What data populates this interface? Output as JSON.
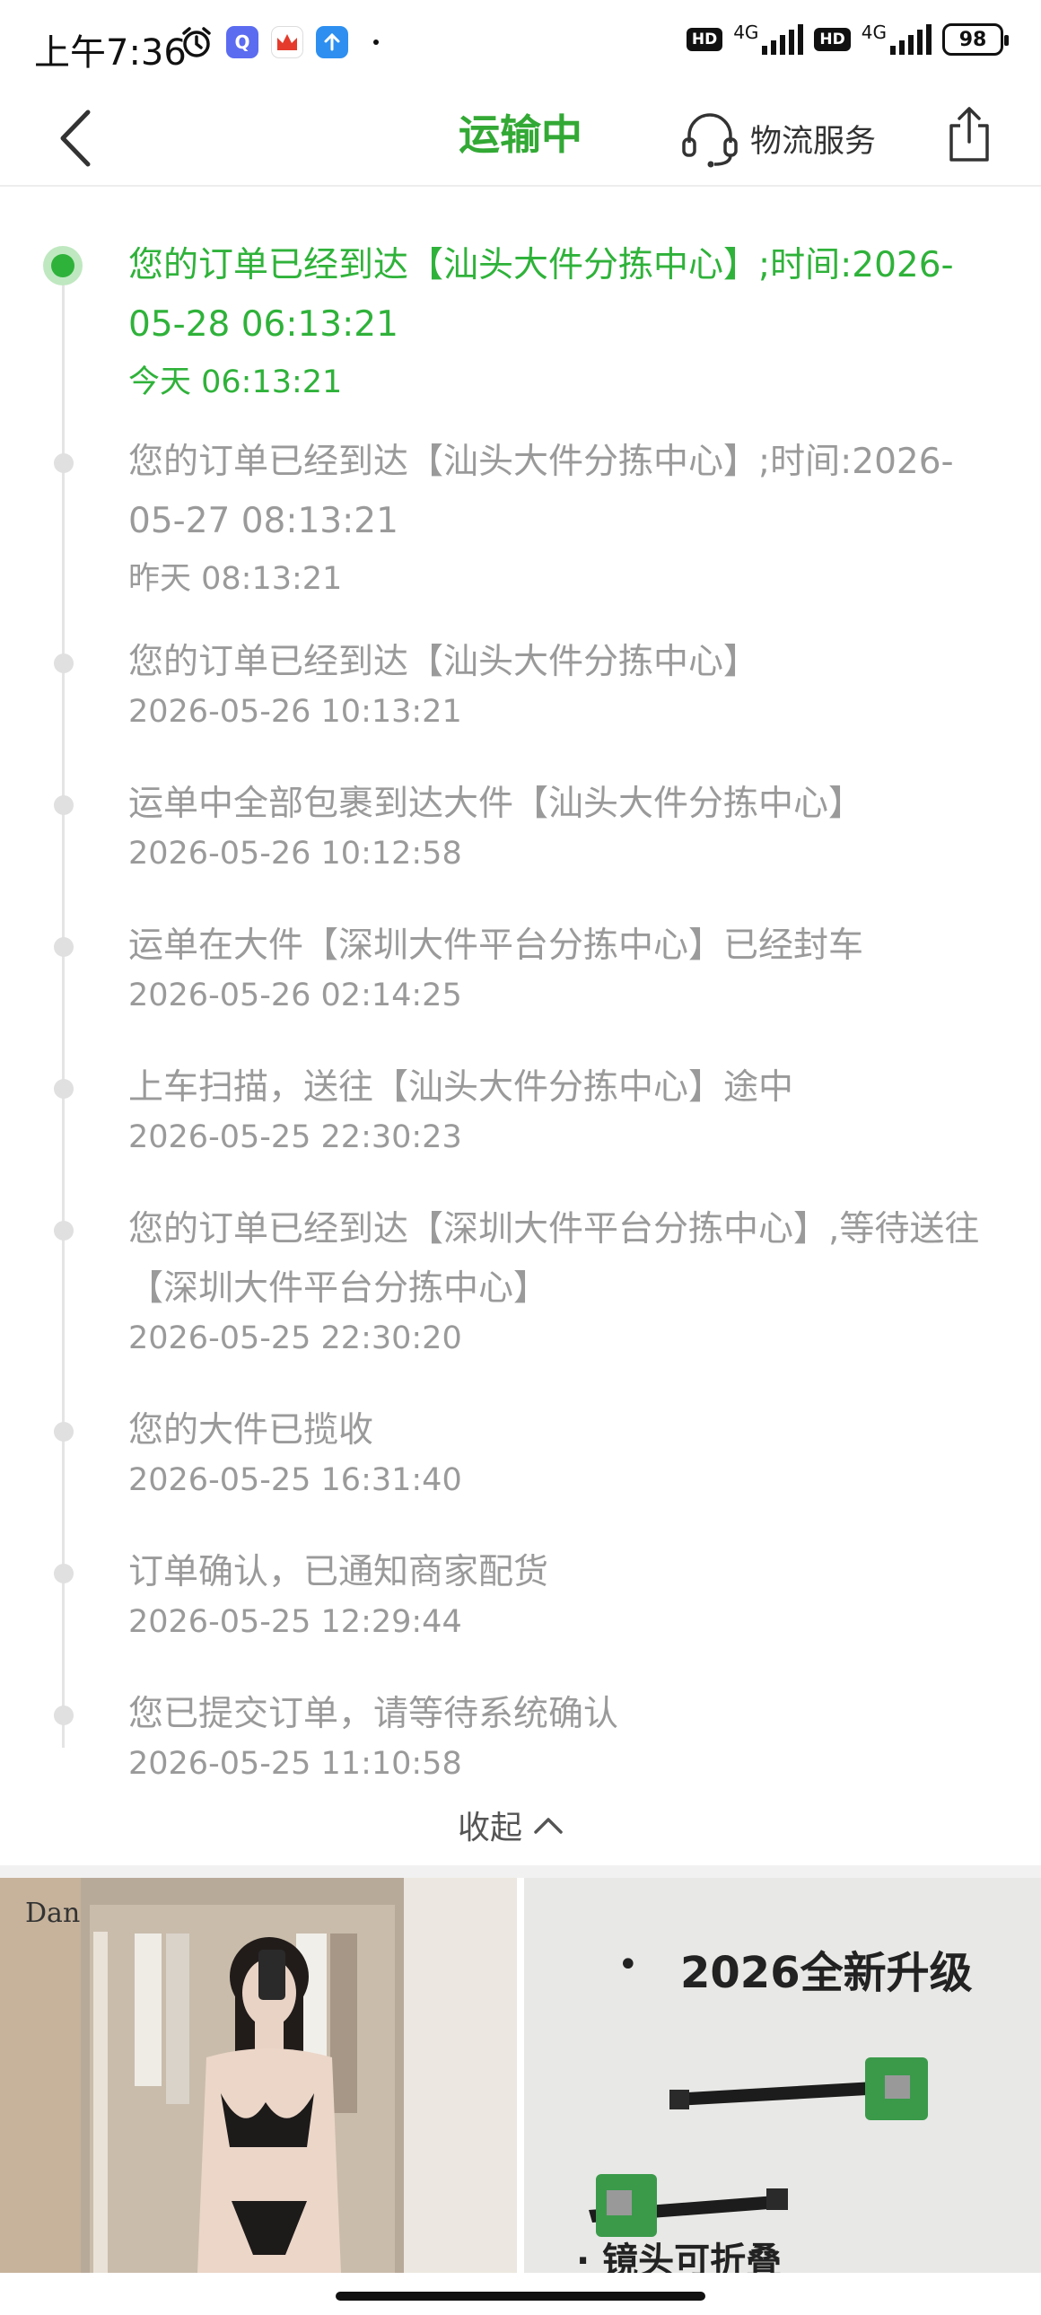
{
  "status_bar": {
    "time": "上午7:36",
    "network1": "4G",
    "network2": "4G",
    "hd1": "HD",
    "hd2": "HD",
    "battery": "98"
  },
  "nav": {
    "title": "运输中",
    "service_label": "物流服务",
    "accent_color": "#33a935"
  },
  "events": [
    {
      "text": "您的订单已经到达【汕头大件分拣中心】;时间:2026-05-28 06:13:21",
      "time": "今天 06:13:21",
      "active": true
    },
    {
      "text": "您的订单已经到达【汕头大件分拣中心】;时间:2026-05-27 08:13:21",
      "time": "昨天 08:13:21"
    },
    {
      "text": "您的订单已经到达【汕头大件分拣中心】",
      "time": "2026-05-26 10:13:21"
    },
    {
      "text": "运单中全部包裹到达大件【汕头大件分拣中心】",
      "time": "2026-05-26 10:12:58"
    },
    {
      "text": "运单在大件【深圳大件平台分拣中心】已经封车",
      "time": "2026-05-26 02:14:25"
    },
    {
      "text": "上车扫描，送往【汕头大件分拣中心】途中",
      "time": "2026-05-25 22:30:23"
    },
    {
      "text": "您的订单已经到达【深圳大件平台分拣中心】,等待送往【深圳大件平台分拣中心】",
      "time": "2026-05-25 22:30:20"
    },
    {
      "text": "您的大件已揽收",
      "time": "2026-05-25 16:31:40"
    },
    {
      "text": "订单确认，已通知商家配货",
      "time": "2026-05-25 12:29:44"
    },
    {
      "text": "您已提交订单，请等待系统确认",
      "time": "2026-05-25 11:10:58"
    }
  ],
  "collapse_label": "收起",
  "gallery": {
    "left": {
      "brand": "Dan"
    },
    "right": {
      "bullet": "•",
      "title": "2026全新升级",
      "subtitle": "· 镜头可折叠"
    }
  }
}
